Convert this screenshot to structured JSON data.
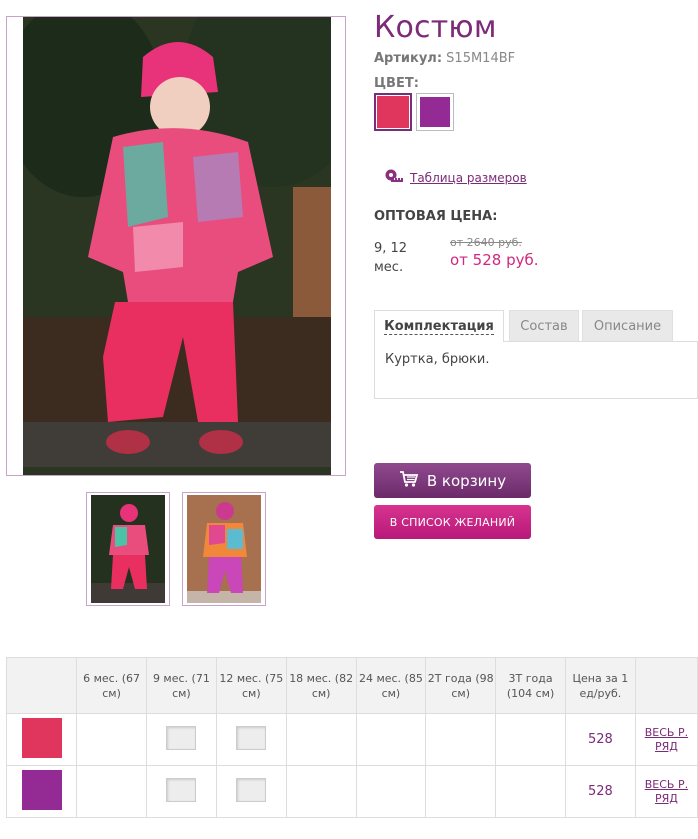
{
  "product": {
    "title": "Костюм",
    "article_label": "Артикул:",
    "article_value": "S15M14BF",
    "color_label": "ЦВЕТ:",
    "colors": [
      {
        "name": "pink",
        "hex": "#e0365e"
      },
      {
        "name": "purple",
        "hex": "#942a94"
      }
    ],
    "size_table_link": "Таблица размеров",
    "size_table_icon": "measuring-tape-icon"
  },
  "pricing": {
    "wholesale_label": "ОПТОВАЯ ЦЕНА:",
    "ages": "9, 12 мес.",
    "old_price": "от 2640 руб.",
    "new_price": "от 528 руб."
  },
  "tabs": [
    {
      "label": "Комплектация",
      "active": true
    },
    {
      "label": "Состав",
      "active": false
    },
    {
      "label": "Описание",
      "active": false
    }
  ],
  "tab_content": "Куртка, брюки.",
  "buttons": {
    "cart_label": "В корзину",
    "cart_icon": "shopping-cart-icon",
    "wishlist_label": "В СПИСОК ЖЕЛАНИЙ"
  },
  "order_grid": {
    "headers": [
      "",
      "6 мес. (67 см)",
      "9 мес. (71 см)",
      "12 мес. (75 см)",
      "18 мес. (82 см)",
      "24 мес. (85 см)",
      "2Т года (98 см)",
      "3Т года (104 см)",
      "Цена за 1 ед/руб.",
      ""
    ],
    "rows": [
      {
        "color": "#e0365e",
        "available": [
          false,
          true,
          true,
          false,
          false,
          false,
          false
        ],
        "price": "528",
        "all_label": "ВЕСЬ Р. РЯД"
      },
      {
        "color": "#942a94",
        "available": [
          false,
          true,
          true,
          false,
          false,
          false,
          false
        ],
        "price": "528",
        "all_label": "ВЕСЬ Р. РЯД"
      }
    ]
  }
}
